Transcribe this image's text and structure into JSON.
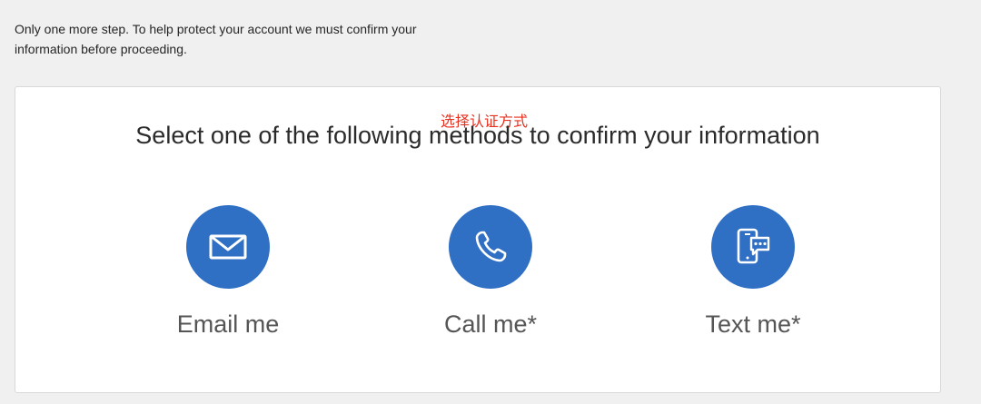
{
  "intro": {
    "line1": "Only one more step. To help protect your account we must confirm your",
    "line2": "information before proceeding."
  },
  "card": {
    "annotation": "选择认证方式",
    "heading": "Select one of the following methods to confirm your information",
    "methods": [
      {
        "label": "Email me",
        "icon": "envelope-icon"
      },
      {
        "label": "Call me*",
        "icon": "phone-icon"
      },
      {
        "label": "Text me*",
        "icon": "sms-icon"
      }
    ]
  },
  "colors": {
    "accent": "#2f6fc4",
    "annotation": "#e8311f",
    "background": "#f0f0f0"
  }
}
